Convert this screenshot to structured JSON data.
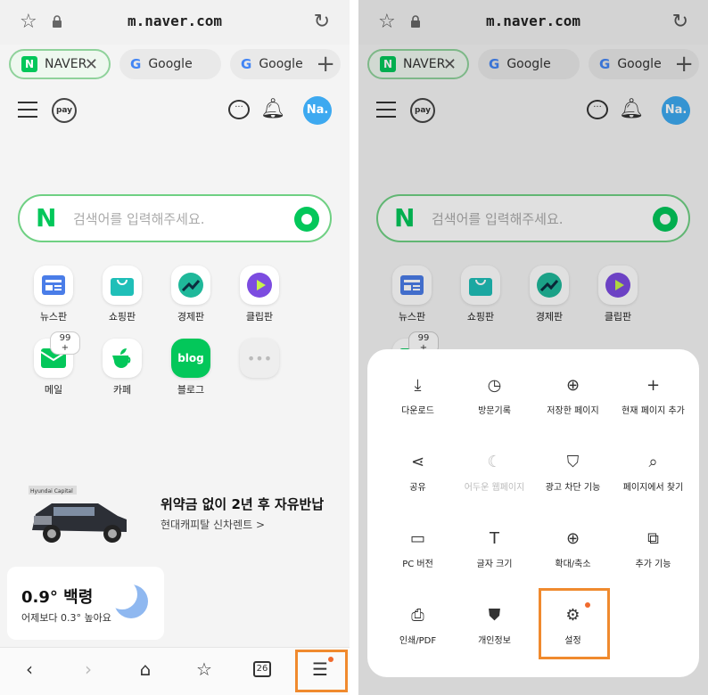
{
  "browser": {
    "url": "m.naver.com",
    "tabs": [
      {
        "label": "NAVER",
        "active": true,
        "badge": "N"
      },
      {
        "label": "Google",
        "active": false,
        "badge": "G"
      },
      {
        "label": "Google",
        "active": false,
        "badge": "G"
      }
    ],
    "add_tab": "+",
    "close_tab": "✕"
  },
  "naver": {
    "pay_label": "pay",
    "avatar": "Na.",
    "search_logo": "N",
    "search_placeholder": "검색어를 입력해주세요.",
    "apps": [
      {
        "label": "뉴스판",
        "icon": "news-icon"
      },
      {
        "label": "쇼핑판",
        "icon": "shopping-icon"
      },
      {
        "label": "경제판",
        "icon": "economy-icon"
      },
      {
        "label": "클립판",
        "icon": "clip-icon"
      },
      {
        "label": "메일",
        "icon": "mail-icon",
        "count": "99 +"
      },
      {
        "label": "카페",
        "icon": "cafe-icon"
      },
      {
        "label": "블로그",
        "icon": "blog-icon",
        "text": "blog"
      },
      {
        "label": "",
        "icon": "more-icon"
      }
    ],
    "ad": {
      "badge": "Hyundai Capital",
      "title": "위약금 없이 2년 후 자유반납",
      "subtitle": "현대캐피탈 신차렌트 >"
    },
    "weather": {
      "temp": "0.9° 백령",
      "sub": "어제보다 0.3° 높아요"
    }
  },
  "bottom_nav": {
    "tab_count": "26"
  },
  "menu": {
    "items": [
      {
        "label": "다운로드",
        "icon": "download-icon",
        "glyph": "⤓"
      },
      {
        "label": "방문기록",
        "icon": "history-icon",
        "glyph": "◷"
      },
      {
        "label": "저장한 페이지",
        "icon": "saved-page-icon",
        "glyph": "⊕"
      },
      {
        "label": "현재 페이지 추가",
        "icon": "add-page-icon",
        "glyph": "+"
      },
      {
        "label": "공유",
        "icon": "share-icon",
        "glyph": "⋖"
      },
      {
        "label": "어두운 웹페이지",
        "icon": "dark-mode-icon",
        "glyph": "☾",
        "disabled": true
      },
      {
        "label": "광고 차단 기능",
        "icon": "ad-block-icon",
        "glyph": "⛉"
      },
      {
        "label": "페이지에서 찾기",
        "icon": "find-in-page-icon",
        "glyph": "⌕"
      },
      {
        "label": "PC 버전",
        "icon": "pc-version-icon",
        "glyph": "▭"
      },
      {
        "label": "글자 크기",
        "icon": "font-size-icon",
        "glyph": "T"
      },
      {
        "label": "확대/축소",
        "icon": "zoom-icon",
        "glyph": "⊕"
      },
      {
        "label": "추가 기능",
        "icon": "extensions-icon",
        "glyph": "⧉"
      },
      {
        "label": "인쇄/PDF",
        "icon": "print-icon",
        "glyph": "⎙"
      },
      {
        "label": "개인정보",
        "icon": "privacy-icon",
        "glyph": "⛊"
      },
      {
        "label": "설정",
        "icon": "settings-icon",
        "glyph": "⚙"
      }
    ]
  },
  "colors": {
    "naver_green": "#03c75a",
    "highlight": "#f08a2e",
    "avatar_blue": "#3da9f0"
  }
}
